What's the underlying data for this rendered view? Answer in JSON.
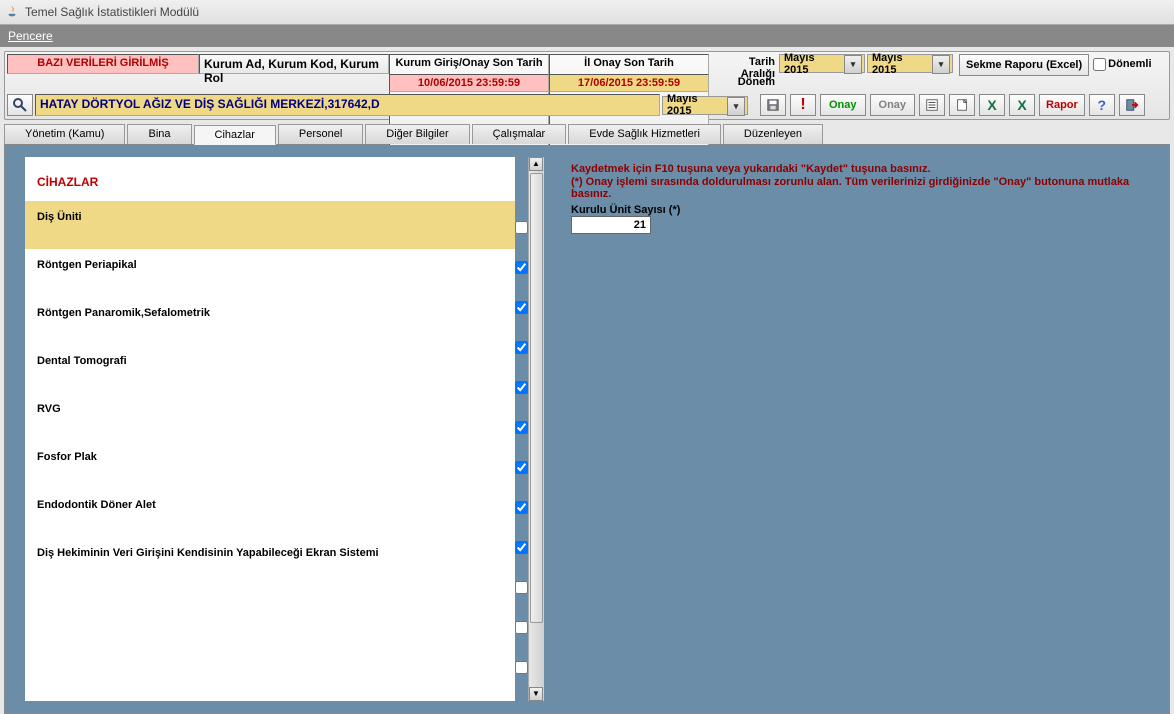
{
  "window": {
    "title": "Temel Sağlık İstatistikleri Modülü"
  },
  "menubar": {
    "pencere": "Pencere"
  },
  "status": "BAZI VERİLERİ GİRİLMİŞ",
  "kurum_label": "Kurum Ad, Kurum Kod, Kurum Rol",
  "dates": {
    "kurum_header": "Kurum Giriş/Onay Son Tarih",
    "kurum_value": "10/06/2015 23:59:59",
    "il_header": "İl Onay Son Tarih",
    "il_value": "17/06/2015 23:59:59"
  },
  "tarih": {
    "label": "Tarih Aralığı",
    "donem": "Dönem",
    "from": "Mayıs   2015",
    "to": "Mayıs   2015"
  },
  "sekme_raporu": "Sekme Raporu (Excel)",
  "donemli": "Dönemli",
  "kurum_value": "HATAY DÖRTYOL AĞIZ VE DİŞ SAĞLIĞI MERKEZİ,317642,D",
  "row2_month": "Mayıs   2015",
  "onay1": "Onay",
  "onay2": "Onay",
  "rapor": "Rapor",
  "tabs": [
    "Yönetim (Kamu)",
    "Bina",
    "Cihazlar",
    "Personel",
    "Diğer Bilgiler",
    "Çalışmalar",
    "Evde Sağlık Hizmetleri",
    "Düzenleyen"
  ],
  "left": {
    "heading": "CİHAZLAR",
    "items": [
      "Diş Üniti",
      "Röntgen Periapikal",
      "Röntgen Panaromik,Sefalometrik",
      "Dental Tomografi",
      "RVG",
      "Fosfor Plak",
      "Endodontik Döner Alet",
      "Diş Hekiminin Veri Girişini Kendisinin Yapabileceği Ekran Sistemi"
    ]
  },
  "right": {
    "msg1": "Kaydetmek için F10 tuşuna veya yukarıdaki \"Kaydet\" tuşuna basınız.",
    "msg2": "(*) Onay işlemi sırasında doldurulması zorunlu alan. Tüm verilerinizi girdiğinizde \"Onay\" butonuna mutlaka basınız.",
    "field_label": "Kurulu Ünit Sayısı (*)",
    "unit_value": "21"
  }
}
